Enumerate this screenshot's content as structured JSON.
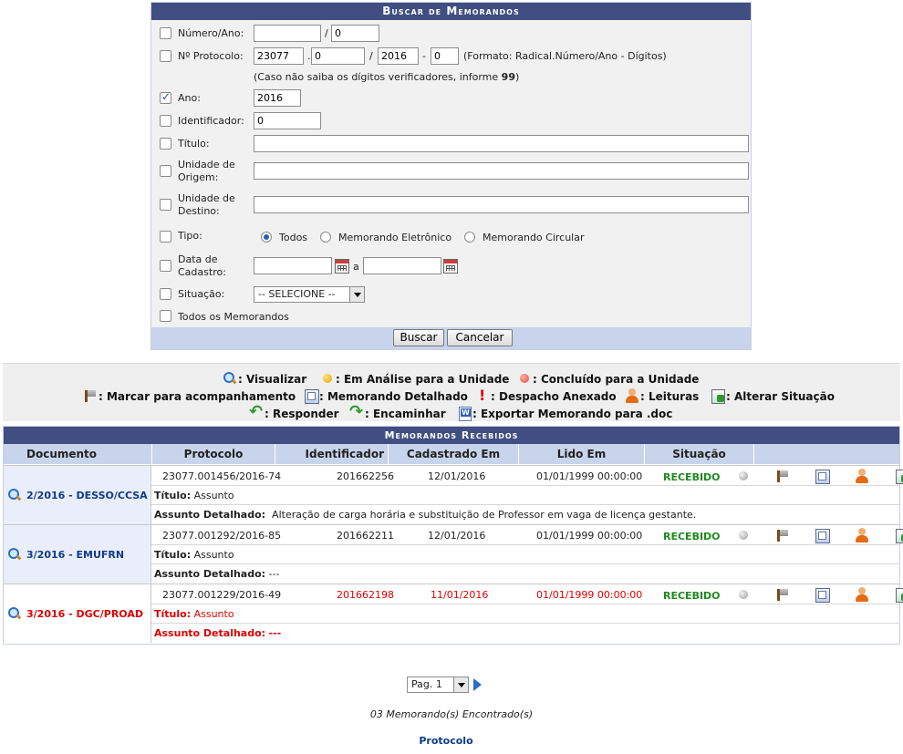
{
  "search": {
    "title": "Buscar de Memorandos",
    "numero_ano_label": "Número/Ano:",
    "numero_value": "",
    "numero_ano_value": "0",
    "protocolo_label": "Nº Protocolo:",
    "protocolo_radical": "23077",
    "protocolo_numero": "0",
    "protocolo_ano": "2016",
    "protocolo_digitos": "0",
    "protocolo_format": "(Formato: Radical.Número/Ano - Dígitos)",
    "protocolo_hint_prefix": "(Caso não saiba os dígitos verificadores, informe",
    "protocolo_hint_value": "99",
    "protocolo_hint_suffix": ")",
    "ano_label": "Ano:",
    "ano_value": "2016",
    "ano_checked": true,
    "identificador_label": "Identificador:",
    "identificador_value": "0",
    "titulo_label": "Título:",
    "titulo_value": "",
    "unidade_origem_label_1": "Unidade de",
    "unidade_origem_label_2": "Origem:",
    "unidade_destino_label_1": "Unidade de",
    "unidade_destino_label_2": "Destino:",
    "tipo_label": "Tipo:",
    "tipo_options": [
      "Todos",
      "Memorando Eletrônico",
      "Memorando Circular"
    ],
    "tipo_selected": "Todos",
    "data_label_1": "Data de",
    "data_label_2": "Cadastro:",
    "data_sep": "a",
    "situacao_label": "Situação:",
    "situacao_value": "-- SELECIONE --",
    "todos_label": "Todos os Memorandos",
    "buscar_label": "Buscar",
    "cancelar_label": "Cancelar"
  },
  "legend": {
    "visualizar": ": Visualizar",
    "em_analise": ": Em Análise para a Unidade",
    "concluido": ": Concluído para a Unidade",
    "marcar": ": Marcar para acompanhamento",
    "detalhado": ": Memorando Detalhado",
    "despacho": ": Despacho Anexado",
    "leituras": ": Leituras",
    "alterar": ": Alterar Situação",
    "responder": ": Responder",
    "encaminhar": ": Encaminhar",
    "exportar": ": Exportar Memorando para .doc"
  },
  "results": {
    "title": "Memorandos Recebidos",
    "headers": [
      "Documento",
      "Protocolo",
      "Identificador",
      "Cadastrado Em",
      "Lido Em",
      "Situação"
    ],
    "titulo_prefix": "Título:",
    "assunto_prefix": "Assunto Detalhado:",
    "rows": [
      {
        "documento": "2/2016 - DESSO/CCSA",
        "protocolo": "23077.001456/2016-74",
        "identificador": "201662256",
        "cadastrado": "12/01/2016",
        "lido": "01/01/1999 00:00:00",
        "situacao": "RECEBIDO",
        "titulo": "Assunto",
        "assunto": "Alteração de carga horária e substituição de Professor em vaga de licença gestante."
      },
      {
        "documento": "3/2016 - EMUFRN",
        "protocolo": "23077.001292/2016-85",
        "identificador": "201662211",
        "cadastrado": "12/01/2016",
        "lido": "01/01/1999 00:00:00",
        "situacao": "RECEBIDO",
        "titulo": "Assunto",
        "assunto": "---"
      },
      {
        "documento": "3/2016 - DGC/PROAD",
        "protocolo": "23077.001229/2016-49",
        "identificador": "201662198",
        "cadastrado": "11/01/2016",
        "lido": "01/01/1999 00:00:00",
        "situacao": "RECEBIDO",
        "titulo": "Assunto",
        "assunto": "---"
      }
    ]
  },
  "footer": {
    "page_select": "Pag. 1",
    "count_text": "03 Memorando(s) Encontrado(s)",
    "link": "Protocolo"
  },
  "colors": {
    "caption_bg": "#404e82",
    "header_bg": "#c8d4ec",
    "status_green": "#1f8a1f",
    "urgent_red": "#e00000"
  }
}
